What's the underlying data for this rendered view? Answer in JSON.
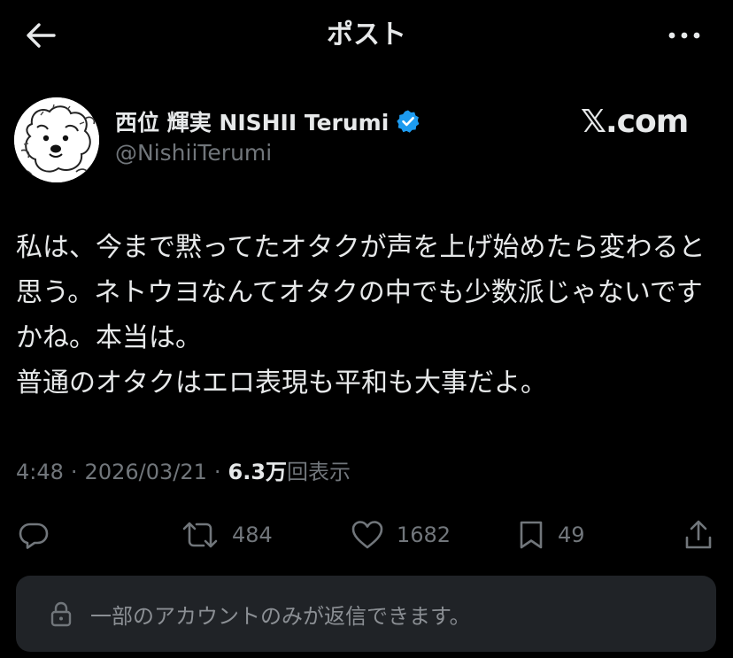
{
  "header": {
    "title": "ポスト",
    "back_icon": "arrow-left-icon",
    "more_icon": "more-horizontal-icon"
  },
  "author": {
    "name": "西位 輝実 NISHII Terumi",
    "handle": "@NishiiTerumi",
    "verified": true,
    "verified_color": "#1d9bf0"
  },
  "source_logo": "𝕏.com",
  "post": {
    "text": "私は、今まで黙ってたオタクが声を上げ始めたら変わると思う。ネトウヨなんてオタクの中でも少数派じゃないですかね。本当は。\n普通のオタクはエロ表現も平和も大事だよ。"
  },
  "meta": {
    "time": "4:48",
    "separator": "·",
    "date": "2026/03/21",
    "views_count": "6.3万",
    "views_label": "回表示"
  },
  "actions": {
    "reply": {
      "icon": "reply-icon"
    },
    "repost": {
      "icon": "repost-icon",
      "count": "484"
    },
    "like": {
      "icon": "heart-icon",
      "count": "1682"
    },
    "bookmark": {
      "icon": "bookmark-icon",
      "count": "49"
    },
    "share": {
      "icon": "share-icon"
    }
  },
  "reply_restriction": {
    "icon": "lock-icon",
    "text": "一部のアカウントのみが返信できます。"
  },
  "colors": {
    "background": "#000000",
    "text_primary": "#e7e9ea",
    "text_secondary": "#71767b",
    "reply_box": "#202327",
    "accent": "#1d9bf0"
  }
}
